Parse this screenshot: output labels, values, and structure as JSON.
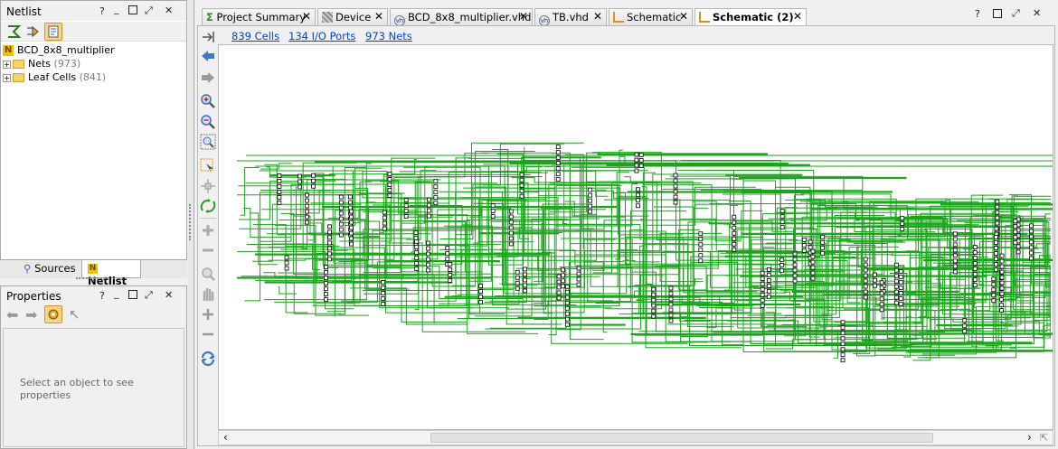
{
  "netlist_panel": {
    "title": "Netlist",
    "controls": [
      "?",
      "_",
      "□",
      "⤢",
      "✕"
    ],
    "tree": {
      "root": "BCD_8x8_multiplier",
      "children": [
        {
          "label": "Nets",
          "count": "(973)"
        },
        {
          "label": "Leaf Cells",
          "count": "(841)"
        }
      ]
    },
    "bottom_tabs": [
      "Sources",
      "Netlist"
    ]
  },
  "properties_panel": {
    "title": "Properties",
    "empty_message": "Select an object to see properties"
  },
  "editor": {
    "tabs": [
      {
        "label": "Project Summary",
        "icon": "sigma-icon",
        "active": false
      },
      {
        "label": "Device",
        "icon": "chip-icon",
        "active": false
      },
      {
        "label": "BCD_8x8_multiplier.vhd",
        "icon": "vhdl-file-icon",
        "active": false
      },
      {
        "label": "TB.vhd",
        "icon": "vhdl-file-icon",
        "active": false
      },
      {
        "label": "Schematic",
        "icon": "schematic-icon",
        "active": false
      },
      {
        "label": "Schematic (2)",
        "icon": "schematic-icon",
        "active": true
      }
    ],
    "stats": {
      "cells": "839 Cells",
      "io_ports": "134 I/O Ports",
      "nets": "973 Nets"
    },
    "colors": {
      "wire": "#1aa51a",
      "link": "#0645c8",
      "accent_orange": "#f0a030"
    }
  }
}
